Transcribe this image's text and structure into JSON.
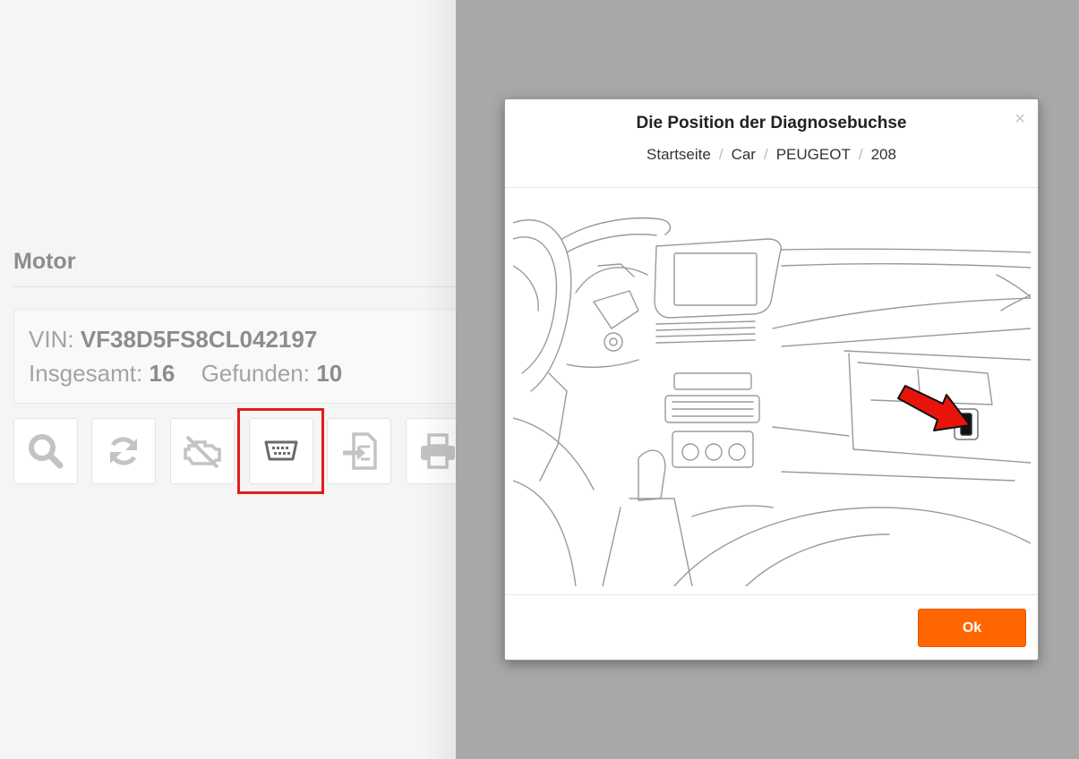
{
  "page": {
    "section_title": "Motor",
    "vin_label": "VIN:",
    "vin_value": "VF38D5FS8CL042197",
    "total_label": "Insgesamt:",
    "total_value": "16",
    "found_label": "Gefunden:",
    "found_value": "10"
  },
  "toolbar": {
    "buttons": [
      {
        "name": "search-button",
        "icon": "search-icon"
      },
      {
        "name": "refresh-button",
        "icon": "refresh-icon"
      },
      {
        "name": "engine-off-button",
        "icon": "engine-off-icon"
      },
      {
        "name": "obd-connector-button",
        "icon": "obd-connector-icon",
        "highlighted": true
      },
      {
        "name": "import-button",
        "icon": "file-import-icon"
      },
      {
        "name": "print-button",
        "icon": "printer-icon"
      }
    ],
    "highlight_color": "#e01d1d"
  },
  "modal": {
    "title": "Die Position der Diagnosebuchse",
    "close_symbol": "×",
    "breadcrumb": [
      "Startseite",
      "Car",
      "PEUGEOT",
      "208"
    ],
    "breadcrumb_separator": "/",
    "image_icon": "car-interior-diagnostic-socket-illustration",
    "ok_label": "Ok",
    "ok_color": "#ff6600"
  },
  "colors": {
    "overlay": "#a8a8a8",
    "arrow": "#e8140c"
  }
}
